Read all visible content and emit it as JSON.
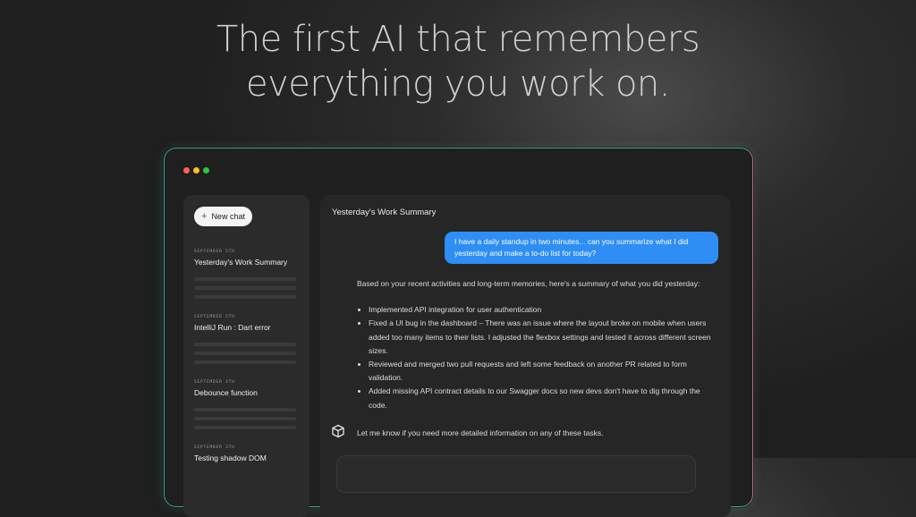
{
  "headline": {
    "line1": "The first AI that remembers",
    "line2": "everything you work on."
  },
  "window": {
    "controls": [
      "close",
      "minimize",
      "maximize"
    ]
  },
  "sidebar": {
    "new_chat_label": "New chat",
    "new_chat_icon": "plus-icon",
    "history": [
      {
        "date": "September 5th",
        "title": "Yesterday's Work Summary"
      },
      {
        "date": "September 5th",
        "title": "IntelliJ Run : Dart error"
      },
      {
        "date": "September 4th",
        "title": "Debounce function"
      },
      {
        "date": "September 3th",
        "title": "Testing shadow DOM"
      }
    ]
  },
  "chat": {
    "title": "Yesterday's Work Summary",
    "user_message": "I have a daily standup in two minutes... can you summarize what I did yesterday and make a to-do list for today?",
    "reply_intro": "Based on your recent activities and long-term memories, here's a summary of what you did yesterday:",
    "reply_items": [
      "Implemented API integration for user authentication",
      "Fixed a UI bug in the dashboard – There was an issue where the layout broke on mobile when users added too many items to their lists. I adjusted the flexbox settings and tested it across different screen sizes.",
      "Reviewed and merged two pull requests and left some feedback on another PR related to form validation.",
      "Added missing API contract details to our Swagger docs so new devs don't have to dig through the code."
    ],
    "closing": "Let me know if you need more detailed information on any of these tasks.",
    "assistant_icon": "assistant-logo-icon",
    "user_bubble_color": "#2e8ef5"
  }
}
